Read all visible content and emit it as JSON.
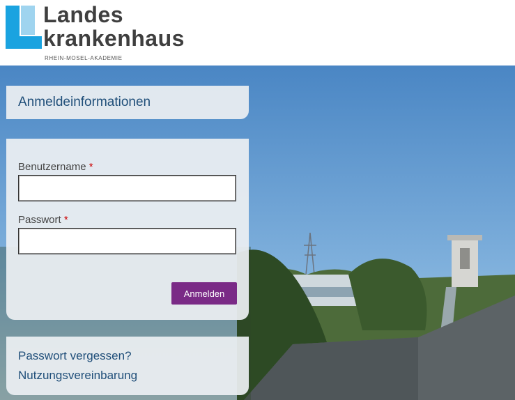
{
  "brand": {
    "title_line1": "Landes",
    "title_line2": "krankenhaus",
    "subtitle": "RHEIN-MOSEL-AKADEMIE",
    "logo_color": "#1aa3e0"
  },
  "login": {
    "section_title": "Anmeldeinformationen",
    "username_label": "Benutzername",
    "password_label": "Passwort",
    "required_mark": "*",
    "username_value": "",
    "password_value": "",
    "submit_label": "Anmelden",
    "submit_color": "#7a2a86"
  },
  "links": {
    "forgot_password": "Passwort vergessen?",
    "terms": "Nutzungsvereinbarung"
  },
  "colors": {
    "link": "#1f4e79",
    "required": "#cc0000"
  }
}
